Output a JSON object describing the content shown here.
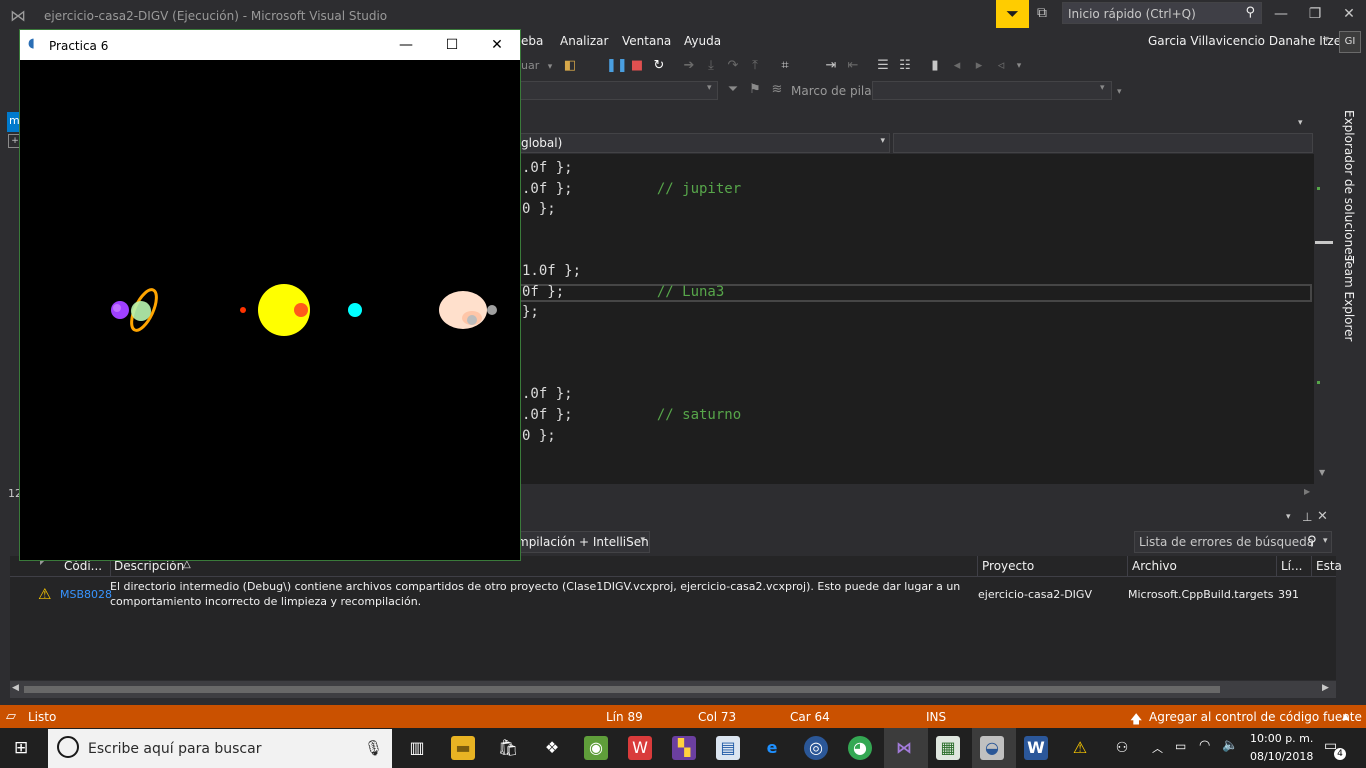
{
  "vs": {
    "title": "ejercicio-casa2-DIGV (Ejecución) - Microsoft Visual Studio",
    "quick_launch_placeholder": "Inicio rápido (Ctrl+Q)",
    "user": "Garcia Villavicencio Danahe Itzel",
    "user_initials": "GI"
  },
  "menu": {
    "items": [
      "eba",
      "Analizar",
      "Ventana",
      "Ayuda"
    ]
  },
  "toolbar": {
    "debug_frame_label": "Marco de pila:",
    "continue_partial": "uar"
  },
  "editor": {
    "scope": "global)",
    "lines": [
      {
        "code": ".0f };",
        "comment": ""
      },
      {
        "code": ".0f };          ",
        "comment": "// jupiter"
      },
      {
        "code": "0 };",
        "comment": ""
      },
      {
        "code": "",
        "comment": ""
      },
      {
        "code": "",
        "comment": ""
      },
      {
        "code": "1.0f };",
        "comment": ""
      },
      {
        "code": "0f };           ",
        "comment": "// Luna3"
      },
      {
        "code": "};",
        "comment": ""
      },
      {
        "code": "",
        "comment": ""
      },
      {
        "code": "",
        "comment": ""
      },
      {
        "code": "",
        "comment": ""
      },
      {
        "code": ".0f };",
        "comment": ""
      },
      {
        "code": ".0f };          ",
        "comment": "// saturno"
      },
      {
        "code": "0 };",
        "comment": ""
      }
    ],
    "line_hint": "12",
    "left_tab_letter": "m"
  },
  "right_tabs": [
    "Explorador de soluciones",
    "Team Explorer"
  ],
  "error_list": {
    "panel_letter": "Li",
    "filter": "mpilación + IntelliSen",
    "search_placeholder": "Lista de errores de búsqueda",
    "columns": [
      "Códi...",
      "Descripción",
      "Proyecto",
      "Archivo",
      "Lí...",
      "Esta"
    ],
    "rows": [
      {
        "code": "MSB8028",
        "description_1": "El directorio intermedio (Debug\\) contiene archivos compartidos de otro proyecto (Clase1DIGV.vcxproj, ejercicio-casa2.vcxproj). Esto puede dar lugar a un",
        "description_2": "comportamiento incorrecto de limpieza y recompilación.",
        "project": "ejercicio-casa2-DIGV",
        "file": "Microsoft.CppBuild.targets",
        "line": "391"
      }
    ]
  },
  "status": {
    "ready": "Listo",
    "line": "Lín 89",
    "col": "Col 73",
    "car": "Car 64",
    "ins": "INS",
    "source_control": "Agregar al control de código fuente"
  },
  "taskbar": {
    "search_placeholder": "Escribe aquí para buscar",
    "time": "10:00 p. m.",
    "date": "08/10/2018",
    "notifications": "4"
  },
  "popup": {
    "title": "Practica 6"
  },
  "colors": {
    "status_bar": "#ca5100",
    "accent": "#007acc",
    "comment": "#57a64a",
    "popup_bg": "#000000",
    "sun": "#ffff00"
  }
}
